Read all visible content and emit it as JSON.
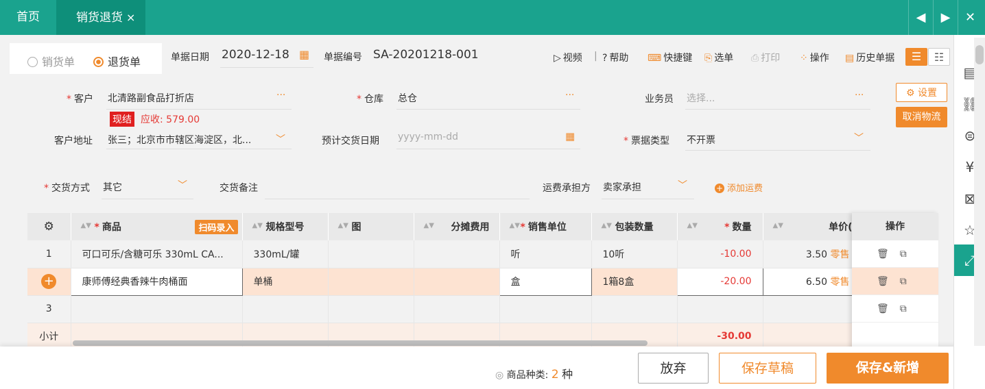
{
  "tabs": {
    "home": "首页",
    "active": "销货退货",
    "close": "×"
  },
  "nav": {
    "prev": "◀",
    "next": "▶",
    "close": "✕"
  },
  "doc_type": {
    "sales": "销货单",
    "return": "退货单"
  },
  "header": {
    "date_label": "单据日期",
    "date_value": "2020-12-18",
    "no_label": "单据编号",
    "no_value": "SA-20201218-001"
  },
  "toolbar": {
    "video": "视频",
    "sep": "|",
    "help": "帮助",
    "shortcut": "快捷键",
    "pick": "选单",
    "print": "打印",
    "ops": "操作",
    "history": "历史单据"
  },
  "form": {
    "customer_label": "客户",
    "customer_value": "北清路副食品打折店",
    "settled_badge": "现结",
    "receivable": "应收: 579.00",
    "warehouse_label": "仓库",
    "warehouse_value": "总仓",
    "salesman_label": "业务员",
    "salesman_placeholder": "选择...",
    "address_label": "客户地址",
    "address_value": "张三；北京市市辖区海淀区，北...",
    "delivery_date_label": "预计交货日期",
    "delivery_date_placeholder": "yyyy-mm-dd",
    "invoice_label": "票据类型",
    "invoice_value": "不开票",
    "settings_btn": "设置",
    "cancel_logistics_btn": "取消物流",
    "delivery_method_label": "交货方式",
    "delivery_method_value": "其它",
    "delivery_note_label": "交货备注",
    "freight_label": "运费承担方",
    "freight_value": "卖家承担",
    "add_freight": "添加运费"
  },
  "grid": {
    "headers": {
      "product": "商品",
      "scan": "扫码录入",
      "spec": "规格型号",
      "image": "图",
      "cost": "分摊费用",
      "unit": "销售单位",
      "pack": "包装数量",
      "qty": "数量",
      "price": "单价(",
      "ops": "操作"
    },
    "rows": [
      {
        "no": "1",
        "product": "可口可乐/含糖可乐 330mL CA...",
        "spec": "330mL/罐",
        "unit": "听",
        "pack": "10听",
        "qty": "-10.00",
        "price": "3.50",
        "price_tag": "零售"
      },
      {
        "no": "+",
        "product": "康师傅经典香辣牛肉桶面",
        "spec": "单桶",
        "unit": "盒",
        "pack": "1箱8盒",
        "qty": "-20.00",
        "price": "6.50",
        "price_tag": "零售"
      },
      {
        "no": "3",
        "product": "",
        "spec": "",
        "unit": "",
        "pack": "",
        "qty": "",
        "price": "",
        "price_tag": ""
      }
    ],
    "subtotal_label": "小计",
    "subtotal_qty": "-30.00"
  },
  "footer": {
    "kinds_label": "商品种类:",
    "kinds_value": "2",
    "kinds_unit": "种",
    "discard": "放弃",
    "save_draft": "保存草稿",
    "save_new": "保存&新增"
  },
  "colors": {
    "brand": "#1aa38e",
    "accent": "#f08a2c",
    "danger": "#e53935"
  }
}
